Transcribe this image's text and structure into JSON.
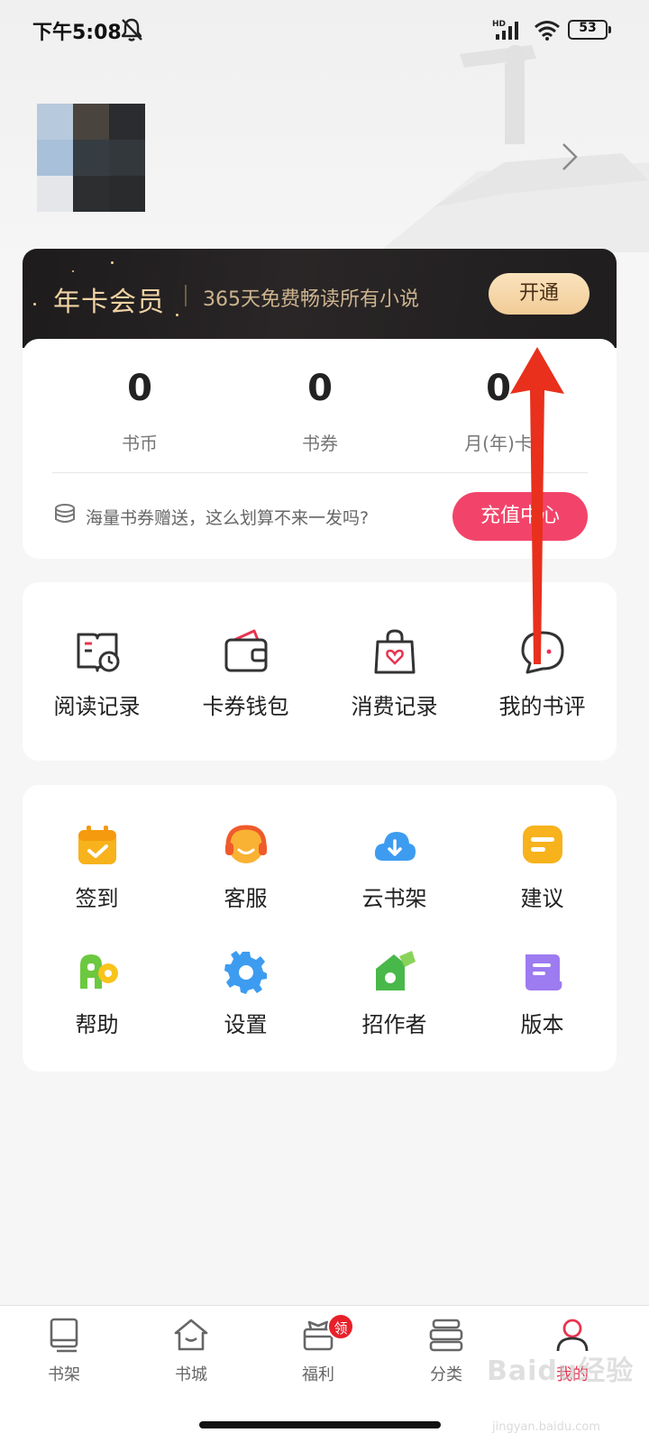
{
  "status_bar": {
    "time": "下午5:08",
    "battery_level": "53",
    "icons": [
      "bell-off-icon",
      "hd-signal-icon",
      "wifi-icon",
      "battery-icon"
    ]
  },
  "profile": {
    "avatar_icon": "avatar-mosaic",
    "chevron_icon": "chevron-right-icon"
  },
  "vip": {
    "title": "年卡会员",
    "description": "365天免费畅读所有小说",
    "button": "开通"
  },
  "wallet": {
    "stats": [
      {
        "value": "0",
        "label": "书币"
      },
      {
        "value": "0",
        "label": "书券"
      },
      {
        "value": "0",
        "label": "月(年)卡"
      }
    ],
    "promo": "海量书券赠送，这么划算不来一发吗?",
    "recharge_button": "充值中心"
  },
  "features": [
    {
      "label": "阅读记录",
      "icon": "reading-history-icon"
    },
    {
      "label": "卡券钱包",
      "icon": "wallet-icon"
    },
    {
      "label": "消费记录",
      "icon": "shopping-bag-icon"
    },
    {
      "label": "我的书评",
      "icon": "comment-icon"
    }
  ],
  "tools": [
    {
      "label": "签到",
      "icon": "calendar-check-icon",
      "color": "#f7b21c"
    },
    {
      "label": "客服",
      "icon": "customer-service-icon",
      "color": "#f57a2a"
    },
    {
      "label": "云书架",
      "icon": "cloud-download-icon",
      "color": "#3d9cf0"
    },
    {
      "label": "建议",
      "icon": "feedback-icon",
      "color": "#f7b21c"
    },
    {
      "label": "帮助",
      "icon": "help-icon",
      "color": "#6cc83f"
    },
    {
      "label": "设置",
      "icon": "gear-icon",
      "color": "#3d9cf0"
    },
    {
      "label": "招作者",
      "icon": "author-house-icon",
      "color": "#49b84a"
    },
    {
      "label": "版本",
      "icon": "version-doc-icon",
      "color": "#9d7bf0"
    }
  ],
  "bottom_nav": {
    "items": [
      {
        "label": "书架",
        "icon": "bookshelf-icon"
      },
      {
        "label": "书城",
        "icon": "home-icon"
      },
      {
        "label": "福利",
        "icon": "gift-icon",
        "badge": "领"
      },
      {
        "label": "分类",
        "icon": "category-icon"
      },
      {
        "label": "我的",
        "icon": "user-icon",
        "active": true
      }
    ]
  },
  "watermark": {
    "text": "Baidu经验",
    "sub": "jingyan.baidu.com"
  },
  "colors": {
    "accent_pink": "#f2446a",
    "vip_gold": "#f0d2a4",
    "annotation_red": "#e8301c"
  }
}
